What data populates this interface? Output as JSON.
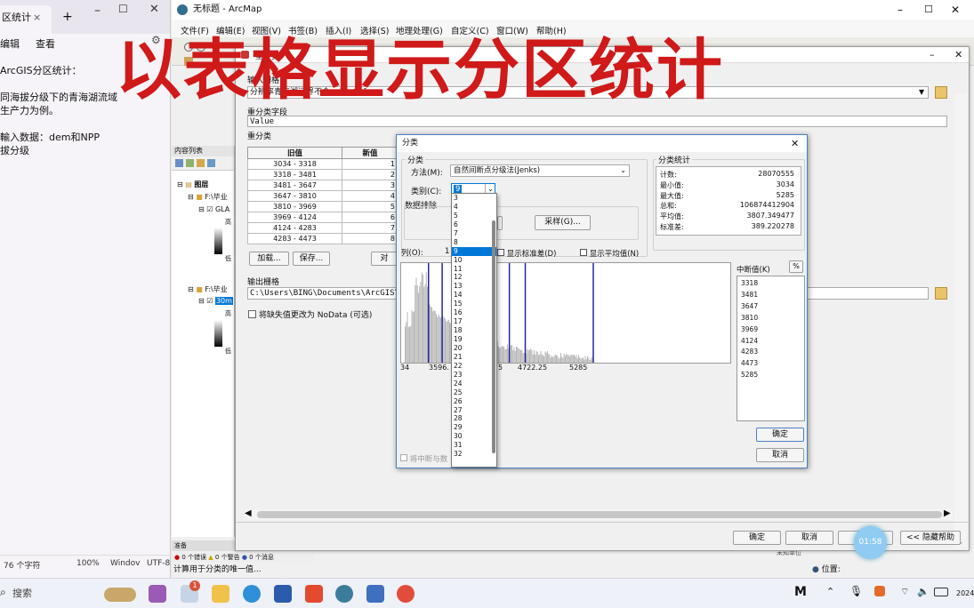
{
  "overlay": {
    "headline": "以表格显示分区统计",
    "timer": "01:58"
  },
  "notepad": {
    "tab_title": "区统计",
    "tab_close": "×",
    "tab_new": "+",
    "menu": [
      "编辑",
      "查看"
    ],
    "lines": [
      "ArcGIS分区统计：",
      "",
      "同海拔分级下的青海湖流域",
      "生产力为例。",
      "",
      "輸入数据：dem和NPP",
      "拔分级"
    ],
    "status": {
      "chars": "76 个字符",
      "zoom": "100%",
      "eol": "Windov",
      "encoding": "UTF-8"
    }
  },
  "arcmap": {
    "title": "无标题 - ArcMap",
    "menu": [
      "文件(F)",
      "编辑(E)",
      "视图(V)",
      "书签(B)",
      "插入(I)",
      "选择(S)",
      "地理处理(G)",
      "自定义(C)",
      "窗口(W)",
      "帮助(H)"
    ],
    "toc": {
      "title": "内容列表",
      "layers_group": "图层",
      "folder1": "F:\\毕业",
      "layer1": "GLA",
      "legend_high": "高",
      "legend_low": "低",
      "folder2": "F:\\毕业",
      "layer2": "30m",
      "legend_high2": "高",
      "legend_low2": "低"
    },
    "status_bar": "计算用于分类的唯一值...",
    "status_tabs": [
      "准备",
      "0 个错误",
      "0 个警告",
      "0 个消息"
    ],
    "coord_label": "位置:",
    "unknown_units": "未知单位"
  },
  "reclass": {
    "title": "重分类",
    "input_label": "输入栅格",
    "input_value": "分辨率青海湖辽界不含..面.tif",
    "field_label": "重分类字段",
    "field_value": "Value",
    "reclass_label": "重分类",
    "table_headers": [
      "旧值",
      "新值"
    ],
    "rows": [
      [
        "3034 - 3318",
        "1"
      ],
      [
        "3318 - 3481",
        "2"
      ],
      [
        "3481 - 3647",
        "3"
      ],
      [
        "3647 - 3810",
        "4"
      ],
      [
        "3810 - 3969",
        "5"
      ],
      [
        "3969 - 4124",
        "6"
      ],
      [
        "4124 - 4283",
        "7"
      ],
      [
        "4283 - 4473",
        "8"
      ]
    ],
    "load_btn": "加载...",
    "save_btn": "保存...",
    "reverse_btn": "对",
    "output_label": "输出栅格",
    "output_value": "C:\\Users\\BING\\Documents\\ArcGIS\\De",
    "nodata_label": "将缺失值更改为 NoData (可选)",
    "ok": "确定",
    "cancel": "取消",
    "env": "环境...",
    "help": "<< 隐藏帮助"
  },
  "classify": {
    "title": "分类",
    "group_class": "分类",
    "method_label": "方法(M):",
    "method_value": "自然间断点分级法(Jenks)",
    "classes_label": "类别(C):",
    "classes_value": "9",
    "exclusion_label": "数据排除",
    "sampling_btn": "采样(G)...",
    "columns_label": "列(O):",
    "columns_value": "1",
    "show_std": "显示标准差(D)",
    "show_mean": "显示平均值(N)",
    "stats_title": "分类统计",
    "stats": [
      [
        "计数:",
        "28070555"
      ],
      [
        "最小值:",
        "3034"
      ],
      [
        "最大值:",
        "5285"
      ],
      [
        "总和:",
        "106874412904"
      ],
      [
        "平均值:",
        "3807.349477"
      ],
      [
        "标准差:",
        "389.220278"
      ]
    ],
    "breaks_title": "中断值(K)",
    "pct_btn": "%",
    "breaks": [
      "3318",
      "3481",
      "3647",
      "3810",
      "3969",
      "4124",
      "4283",
      "4473",
      "5285"
    ],
    "axis_ticks": [
      "34",
      "3596.",
      "5",
      "4722.25",
      "5285"
    ],
    "snap_label": "将中断与数",
    "ok": "确定",
    "cancel": "取消",
    "dropdown_options": [
      "3",
      "4",
      "5",
      "6",
      "7",
      "8",
      "9",
      "10",
      "11",
      "12",
      "13",
      "14",
      "15",
      "16",
      "17",
      "18",
      "19",
      "20",
      "21",
      "22",
      "23",
      "24",
      "25",
      "26",
      "27",
      "28",
      "29",
      "30",
      "31",
      "32"
    ],
    "dropdown_selected": "9"
  },
  "taskbar": {
    "search": "搜索",
    "badge": "1",
    "year": "2024"
  },
  "colors": {
    "headline": "#d01919",
    "accent": "#0078d7",
    "break_line": "#1f2a9e"
  }
}
